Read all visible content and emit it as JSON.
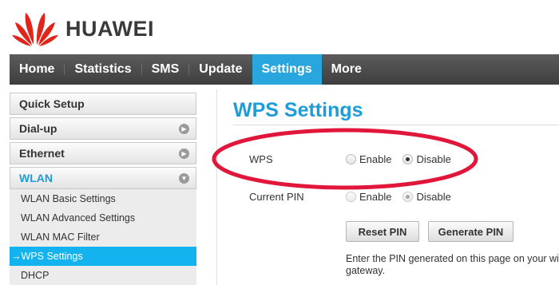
{
  "brand": {
    "name": "HUAWEI",
    "logo_icon": "huawei-petal-logo",
    "logo_color": "#e1251b"
  },
  "nav": {
    "items": [
      {
        "label": "Home"
      },
      {
        "label": "Statistics"
      },
      {
        "label": "SMS"
      },
      {
        "label": "Update"
      },
      {
        "label": "Settings",
        "active": true
      },
      {
        "label": "More"
      }
    ],
    "active_color": "#29a6dd"
  },
  "sidebar": {
    "sections": [
      {
        "label": "Quick Setup"
      },
      {
        "label": "Dial-up",
        "icon": "chevron-right-icon"
      },
      {
        "label": "Ethernet",
        "icon": "chevron-right-icon"
      },
      {
        "label": "WLAN",
        "icon": "chevron-down-icon",
        "open": true
      }
    ],
    "wlan_items": [
      {
        "label": "WLAN Basic Settings"
      },
      {
        "label": "WLAN Advanced Settings"
      },
      {
        "label": "WLAN MAC Filter"
      },
      {
        "label": "→WPS Settings",
        "active": true
      },
      {
        "label": "DHCP"
      }
    ]
  },
  "main": {
    "title": "WPS Settings",
    "wps": {
      "label": "WPS",
      "options": [
        "Enable",
        "Disable"
      ],
      "selected": "Disable"
    },
    "current_pin": {
      "label": "Current PIN",
      "options": [
        "Enable",
        "Disable"
      ],
      "selected": "Disable",
      "disabled": true
    },
    "buttons": {
      "reset": "Reset PIN",
      "generate": "Generate PIN"
    },
    "note_line1": "Enter the PIN generated on this page on your wire",
    "note_line2": "gateway."
  },
  "annotation": {
    "shape": "ellipse",
    "color": "#e0173a"
  }
}
